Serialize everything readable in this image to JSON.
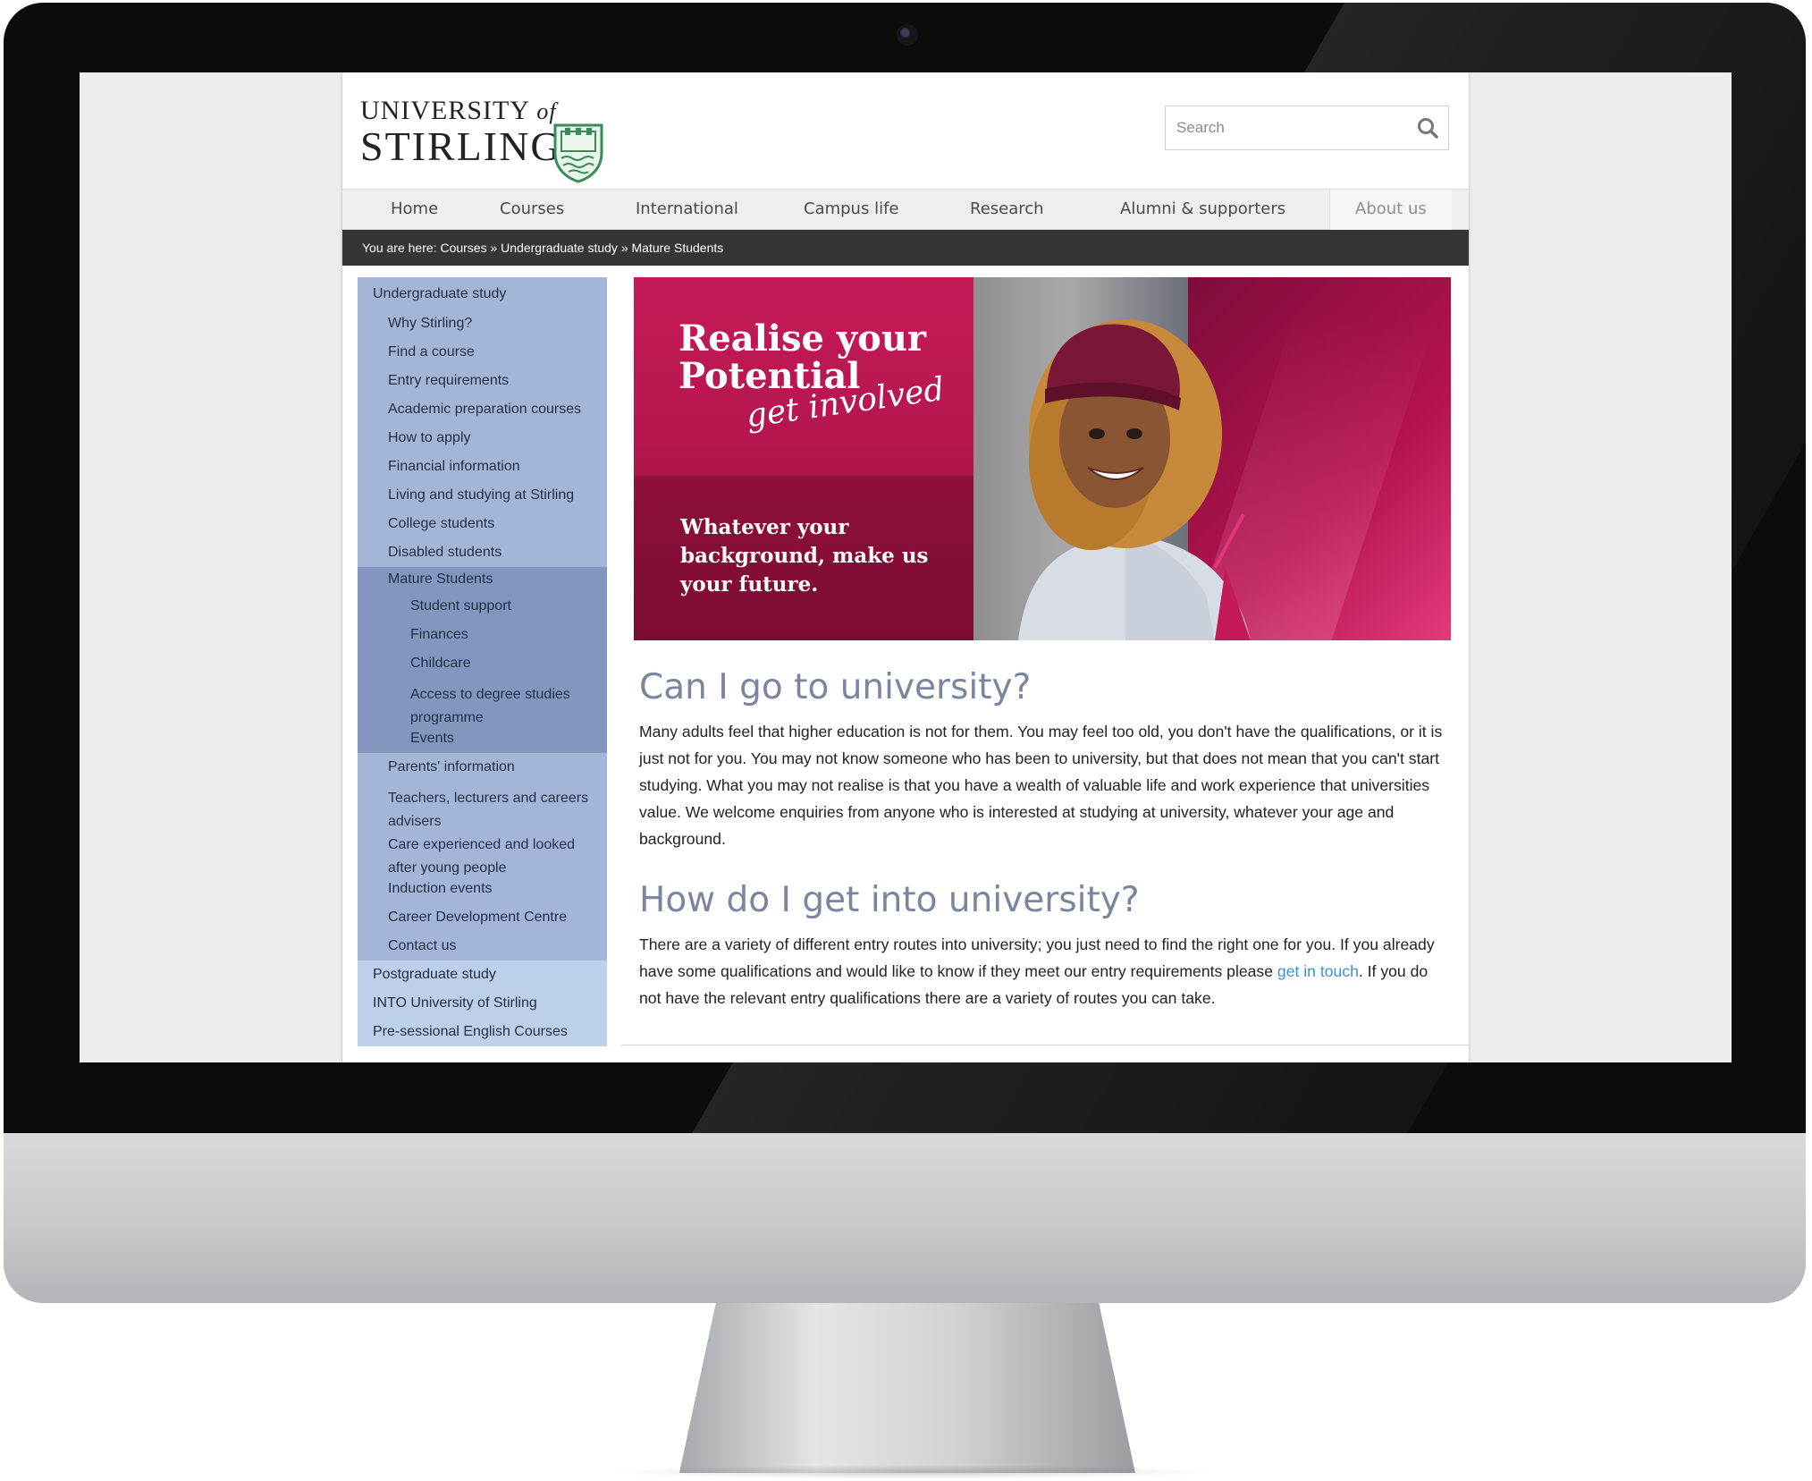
{
  "header": {
    "logo_line1": "UNIVERSITY",
    "logo_of": "of",
    "logo_line2": "STIRLING",
    "search_placeholder": "Search"
  },
  "nav": {
    "items": [
      "Home",
      "Courses",
      "International",
      "Campus life",
      "Research",
      "Alumni & supporters",
      "About us"
    ]
  },
  "breadcrumb": {
    "prefix": "You are here: ",
    "items": [
      "Courses",
      "Undergraduate study",
      "Mature Students"
    ],
    "separator": " » "
  },
  "sidebar": {
    "section": "Undergraduate study",
    "items": [
      "Why Stirling?",
      "Find a course",
      "Entry requirements",
      "Academic preparation courses",
      "How to apply",
      "Financial information",
      "Living and studying at Stirling",
      "College students",
      "Disabled students"
    ],
    "active": "Mature Students",
    "subitems": [
      "Student support",
      "Finances",
      "Childcare",
      "Access to degree studies programme",
      "Events"
    ],
    "items_after": [
      "Parents' information",
      "Teachers, lecturers and careers advisers",
      "Care experienced and looked after young people",
      "Induction events",
      "Career Development Centre",
      "Contact us"
    ],
    "other_sections": [
      "Postgraduate study",
      "INTO University of Stirling",
      "Pre-sessional English Courses"
    ]
  },
  "hero": {
    "title_line1": "Realise your",
    "title_line2": "Potential",
    "script": "get involved",
    "tagline": "Whatever your background, make us your future."
  },
  "content": {
    "heading1": "Can I go to university?",
    "paragraph1": "Many adults feel that higher education is not for them. You may feel too old, you don't have the qualifications, or it is just not for you. You may not know someone who has been to university, but that does not mean that you can't start studying. What you may not realise is that you have a wealth of valuable life and work experience that universities value. We welcome enquiries from anyone who is interested at studying at university, whatever your age and background.",
    "heading2": "How do I get into university?",
    "paragraph2_before": "There are a variety of different entry routes into university; you just need to find the right one for you. If you already have some qualifications and would like to know if they meet our entry requirements please ",
    "paragraph2_link": "get in touch",
    "paragraph2_after": ". If you do not have the relevant entry qualifications there are a variety of routes you can take."
  },
  "colors": {
    "sidebar_blue": "#a3b6d8",
    "sidebar_active": "#8296bf",
    "sidebar_alt": "#bccfeb",
    "hero_magenta": "#c41a59",
    "heading_grey_blue": "#7a85a0",
    "link_blue": "#3d8fd6",
    "breadcrumb_dark": "#353535"
  }
}
